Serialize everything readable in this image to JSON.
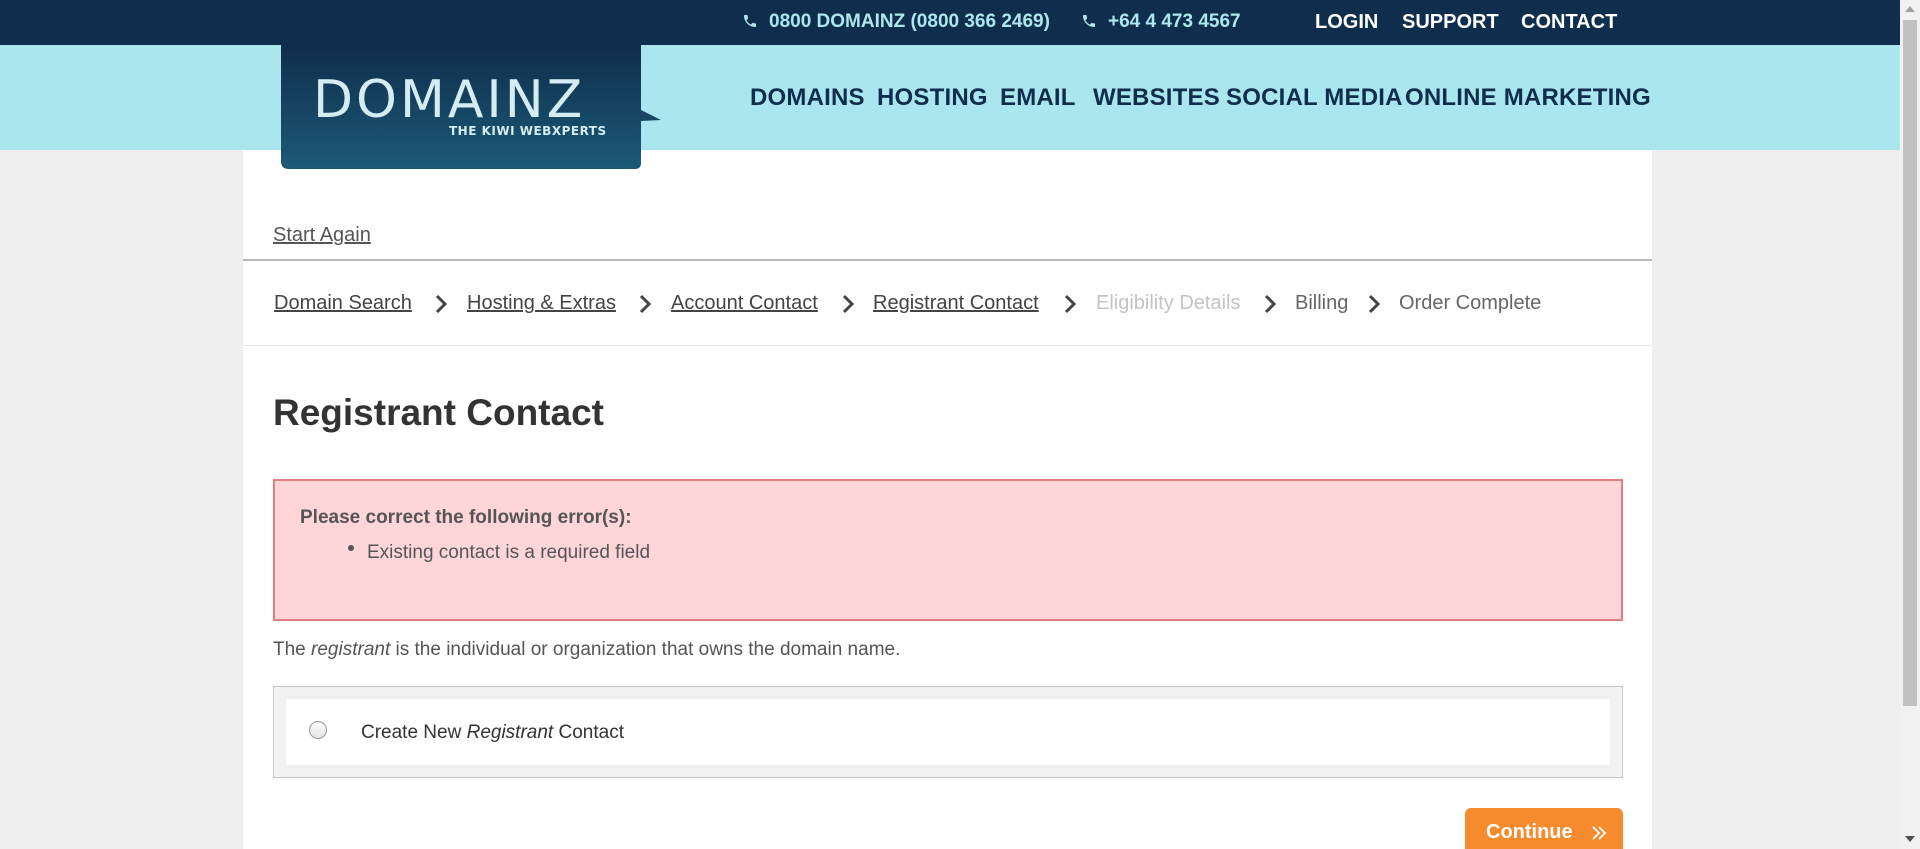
{
  "topbar": {
    "phone1": "0800 DOMAINZ (0800 366 2469)",
    "phone2": "+64 4 473 4567",
    "links": {
      "login": "LOGIN",
      "support": "SUPPORT",
      "contact": "CONTACT"
    }
  },
  "logo": {
    "name": "DOMAINZ",
    "tagline": "THE KIWI WEBXPERTS"
  },
  "nav": {
    "domains": "DOMAINS",
    "hosting": "HOSTING",
    "email": "EMAIL",
    "websites": "WEBSITES",
    "social_media": "SOCIAL MEDIA",
    "online_marketing": "ONLINE MARKETING"
  },
  "start_again": "Start Again",
  "steps": {
    "domain_search": "Domain Search",
    "hosting_extras": "Hosting & Extras",
    "account_contact": "Account Contact",
    "registrant_contact": "Registrant Contact",
    "eligibility_details": "Eligibility Details",
    "billing": "Billing",
    "order_complete": "Order Complete"
  },
  "page_title": "Registrant Contact",
  "error": {
    "title": "Please correct the following error(s):",
    "items": [
      "Existing contact is a required field"
    ]
  },
  "description": {
    "before": "The ",
    "em": "registrant",
    "after": " is the individual or organization that owns the domain name."
  },
  "option": {
    "before": "Create New ",
    "em": "Registrant",
    "after": " Contact"
  },
  "continue_label": "Continue",
  "colors": {
    "topbar": "#0f2d4c",
    "navband": "#aae6ed",
    "accent_orange": "#f58b2c",
    "error_bg": "#ffd6d7",
    "error_border": "#e07e84"
  },
  "icons": [
    "phone-icon",
    "chevron-right-icon",
    "double-chevron-right-icon"
  ]
}
